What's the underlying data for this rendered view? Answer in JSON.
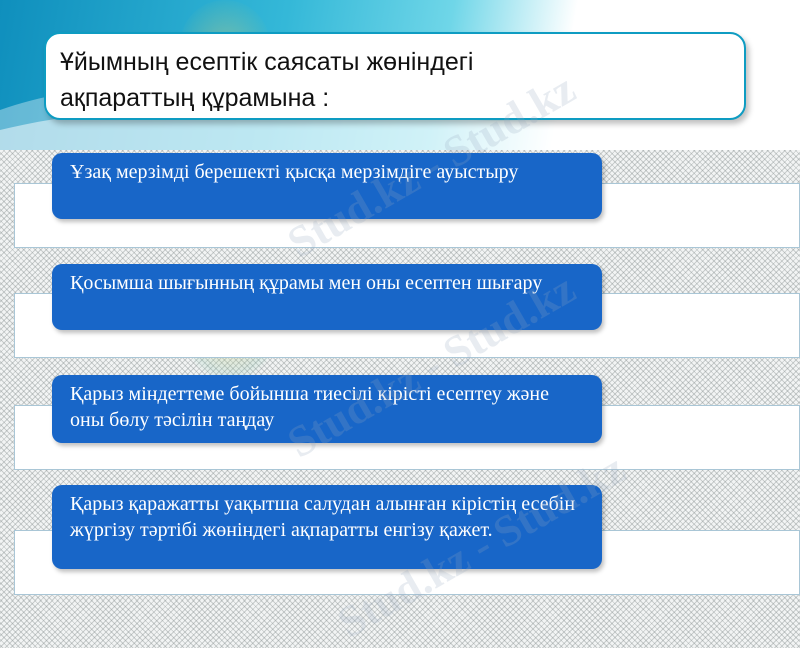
{
  "slide": {
    "title_line1": "Ұйымның есептік саясаты жөніндегі",
    "title_line2": "ақпараттың құрамына :",
    "watermark": "Stud.kz - Stud.kz",
    "items": [
      {
        "text": "Ұзақ мерзімді берешекті қысқа мерзімдіге ауыстыру"
      },
      {
        "text": "Қосымша шығынның құрамы мен оны есептен шығару"
      },
      {
        "text": "Қарыз міндеттеме бойынша тиесілі кірісті есептеу және оны бөлу тәсілін таңдау"
      },
      {
        "text": "Қарыз қаражатты уақытша салудан алынған кірістің есебін жүргізу тәртібі  жөніндегі ақпаратты енгізу қажет."
      }
    ]
  },
  "colors": {
    "pill": "#1866c8",
    "title_border": "#0e9cc2",
    "band": "#34b8d8"
  }
}
